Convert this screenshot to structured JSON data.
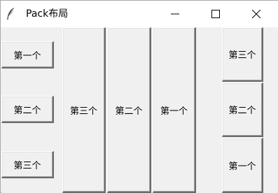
{
  "window": {
    "title": "Pack布局",
    "icon": "feather-icon",
    "controls": [
      "minimize-icon",
      "maximize-icon",
      "close-icon"
    ]
  },
  "left_column": {
    "buttons": [
      {
        "label": "第一个"
      },
      {
        "label": "第二个"
      },
      {
        "label": "第三个"
      }
    ]
  },
  "vertical_buttons": [
    {
      "label": "第三个"
    },
    {
      "label": "第二个"
    },
    {
      "label": "第一个"
    }
  ],
  "right_column": {
    "buttons": [
      {
        "label": "第三个"
      },
      {
        "label": "第二个"
      },
      {
        "label": "第一个"
      }
    ]
  }
}
